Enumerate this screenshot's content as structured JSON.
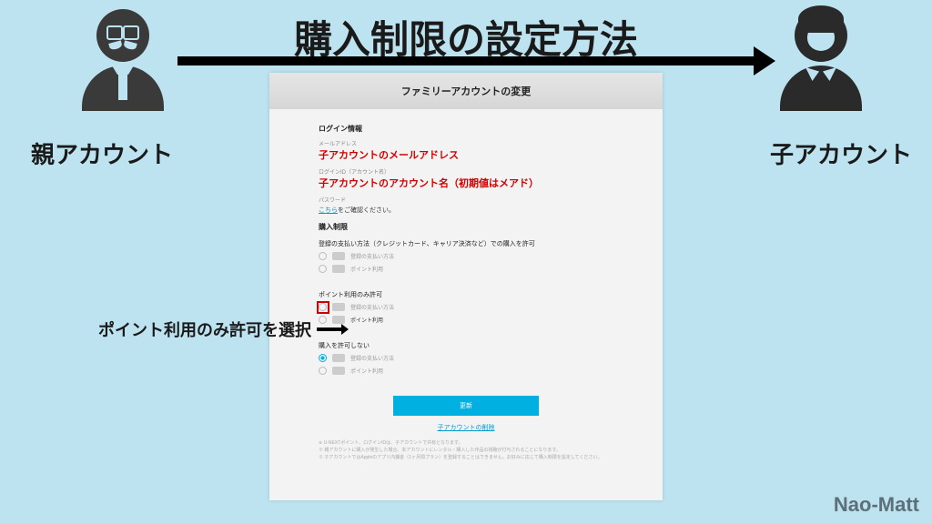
{
  "title": "購入制限の設定方法",
  "parent_label": "親アカウント",
  "child_label": "子アカウント",
  "annotation_text": "ポイント利用のみ許可を選択",
  "watermark": "Nao-Matt",
  "screenshot": {
    "header": "ファミリーアカウントの変更",
    "login_section": "ログイン情報",
    "email_label": "メールアドレス",
    "email_overlay": "子アカウントのメールアドレス",
    "loginid_label": "ログインID（アカウント名）",
    "loginid_overlay": "子アカウントのアカウント名（初期値はメアド）",
    "password_label": "パスワード",
    "password_link": "こちら",
    "password_suffix": "をご確認ください。",
    "purchase_section": "購入制限",
    "option1_label": "登録の支払い方法（クレジットカード、キャリア決済など）での購入を許可",
    "option1_row1": "登録の支払い方法",
    "option1_row2": "ポイント利用",
    "option2_label": "ポイント利用のみ許可",
    "option2_row1": "登録の支払い方法",
    "option2_row2": "ポイント利用",
    "option3_label": "購入を許可しない",
    "option3_row1": "登録の支払い方法",
    "option3_row2": "ポイント利用",
    "update_btn": "更新",
    "delete_link": "子アカウントの削除",
    "note1": "※ U-NEXTポイント、ログインIDは、子アカウントで共有となります。",
    "note2": "※ 親アカウントに購入が発生した場合、本アカウントにレンタル・購入した作品の視聴が付与されることになります。",
    "note3": "※ 子アカウントではAppleのアプリ内課金（1ヶ月間プラン）を登録することはできません。お好みに応じて購入制限を設定してください。"
  }
}
